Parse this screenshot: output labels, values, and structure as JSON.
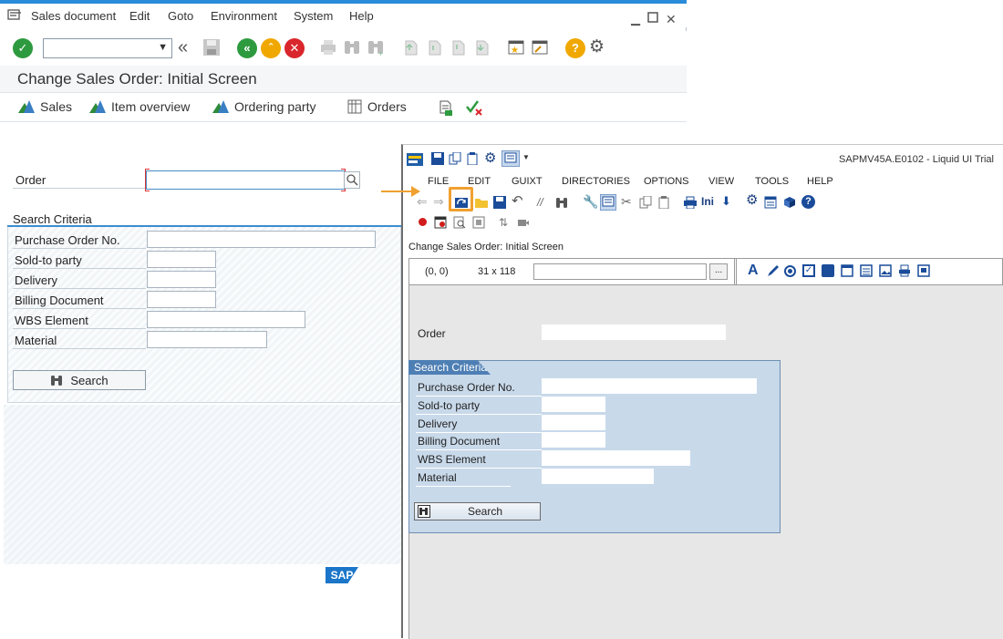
{
  "sap": {
    "menu": [
      "Sales document",
      "Edit",
      "Goto",
      "Environment",
      "System",
      "Help"
    ],
    "title": "Change Sales Order: Initial Screen",
    "appbar": {
      "sales": "Sales",
      "item_overview": "Item overview",
      "ordering_party": "Ordering party",
      "orders": "Orders"
    },
    "order_label": "Order",
    "search_criteria": {
      "title": "Search Criteria",
      "fields": [
        "Purchase Order No.",
        "Sold-to party",
        "Delivery",
        "Billing Document",
        "WBS Element",
        "Material"
      ]
    },
    "search_button": "Search",
    "logo": "SAP"
  },
  "lui": {
    "title": "SAPMV45A.E0102 - Liquid UI Trial",
    "menu": [
      "FILE",
      "EDIT",
      "GUIXT",
      "DIRECTORIES",
      "OPTIONS",
      "VIEW",
      "TOOLS",
      "HELP"
    ],
    "screen_title": "Change Sales Order: Initial Screen",
    "coords": "(0, 0)",
    "size": "31 x 118",
    "ellipsis": "...",
    "order_label": "Order",
    "search_criteria": {
      "title": "Search Criteria",
      "fields": [
        "Purchase Order No.",
        "Sold-to party",
        "Delivery",
        "Billing Document",
        "WBS Element",
        "Material"
      ]
    },
    "search_button": "Search",
    "toolbar_ini": "Ini"
  },
  "colors": {
    "sap_accent": "#2a8bd8",
    "highlight": "#f0a030",
    "group_bg": "#c8d9ea",
    "group_tab": "#4e7fb4"
  }
}
